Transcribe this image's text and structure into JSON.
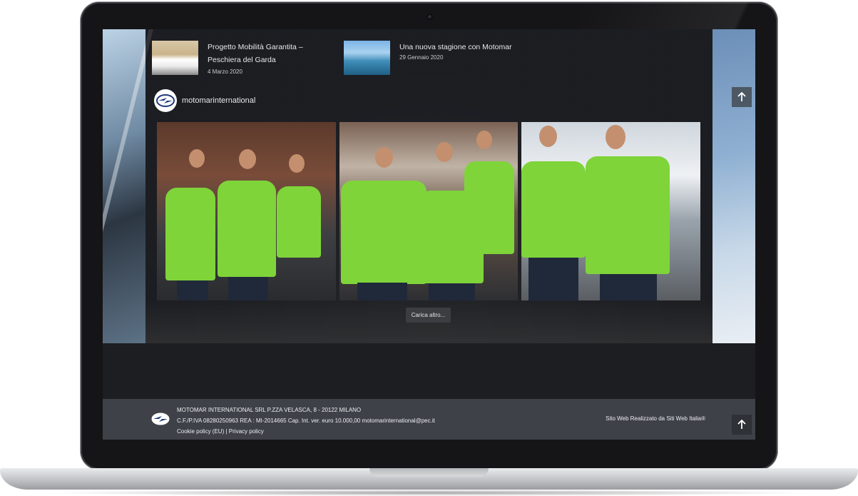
{
  "posts": [
    {
      "title_line1": "Progetto Mobilità Garantita –",
      "title_line2": "Peschiera del Garda",
      "date": "4 Marzo 2020"
    },
    {
      "title_line1": "Una nuova stagione con Motomar",
      "title_line2": "",
      "date": "29 Gennaio 2020"
    }
  ],
  "instagram": {
    "username": "motomarinternational",
    "load_more": "Carica altro..."
  },
  "footer": {
    "line1": "MOTOMAR INTERNATIONAL SRL P.ZZA VELASCA, 8 - 20122 MILANO",
    "line2": "C.F./P.IVA 08280250963 REA : MI-2014665 Cap. Int. ver. euro 10.000,00 motomarinternational@pec.it",
    "cookie_link": "Cookie policy (EU)",
    "separator": "|",
    "privacy_link": "Privacy policy",
    "credit": "Sito Web Realizzato da Siti Web Italia®"
  },
  "icons": {
    "back_to_top": "arrow-up-icon",
    "logo": "motomar-logo-icon"
  },
  "colors": {
    "content_bg": "#202226",
    "footer_bg": "#3e4148",
    "accent_shirt_green": "#7fd43a"
  }
}
